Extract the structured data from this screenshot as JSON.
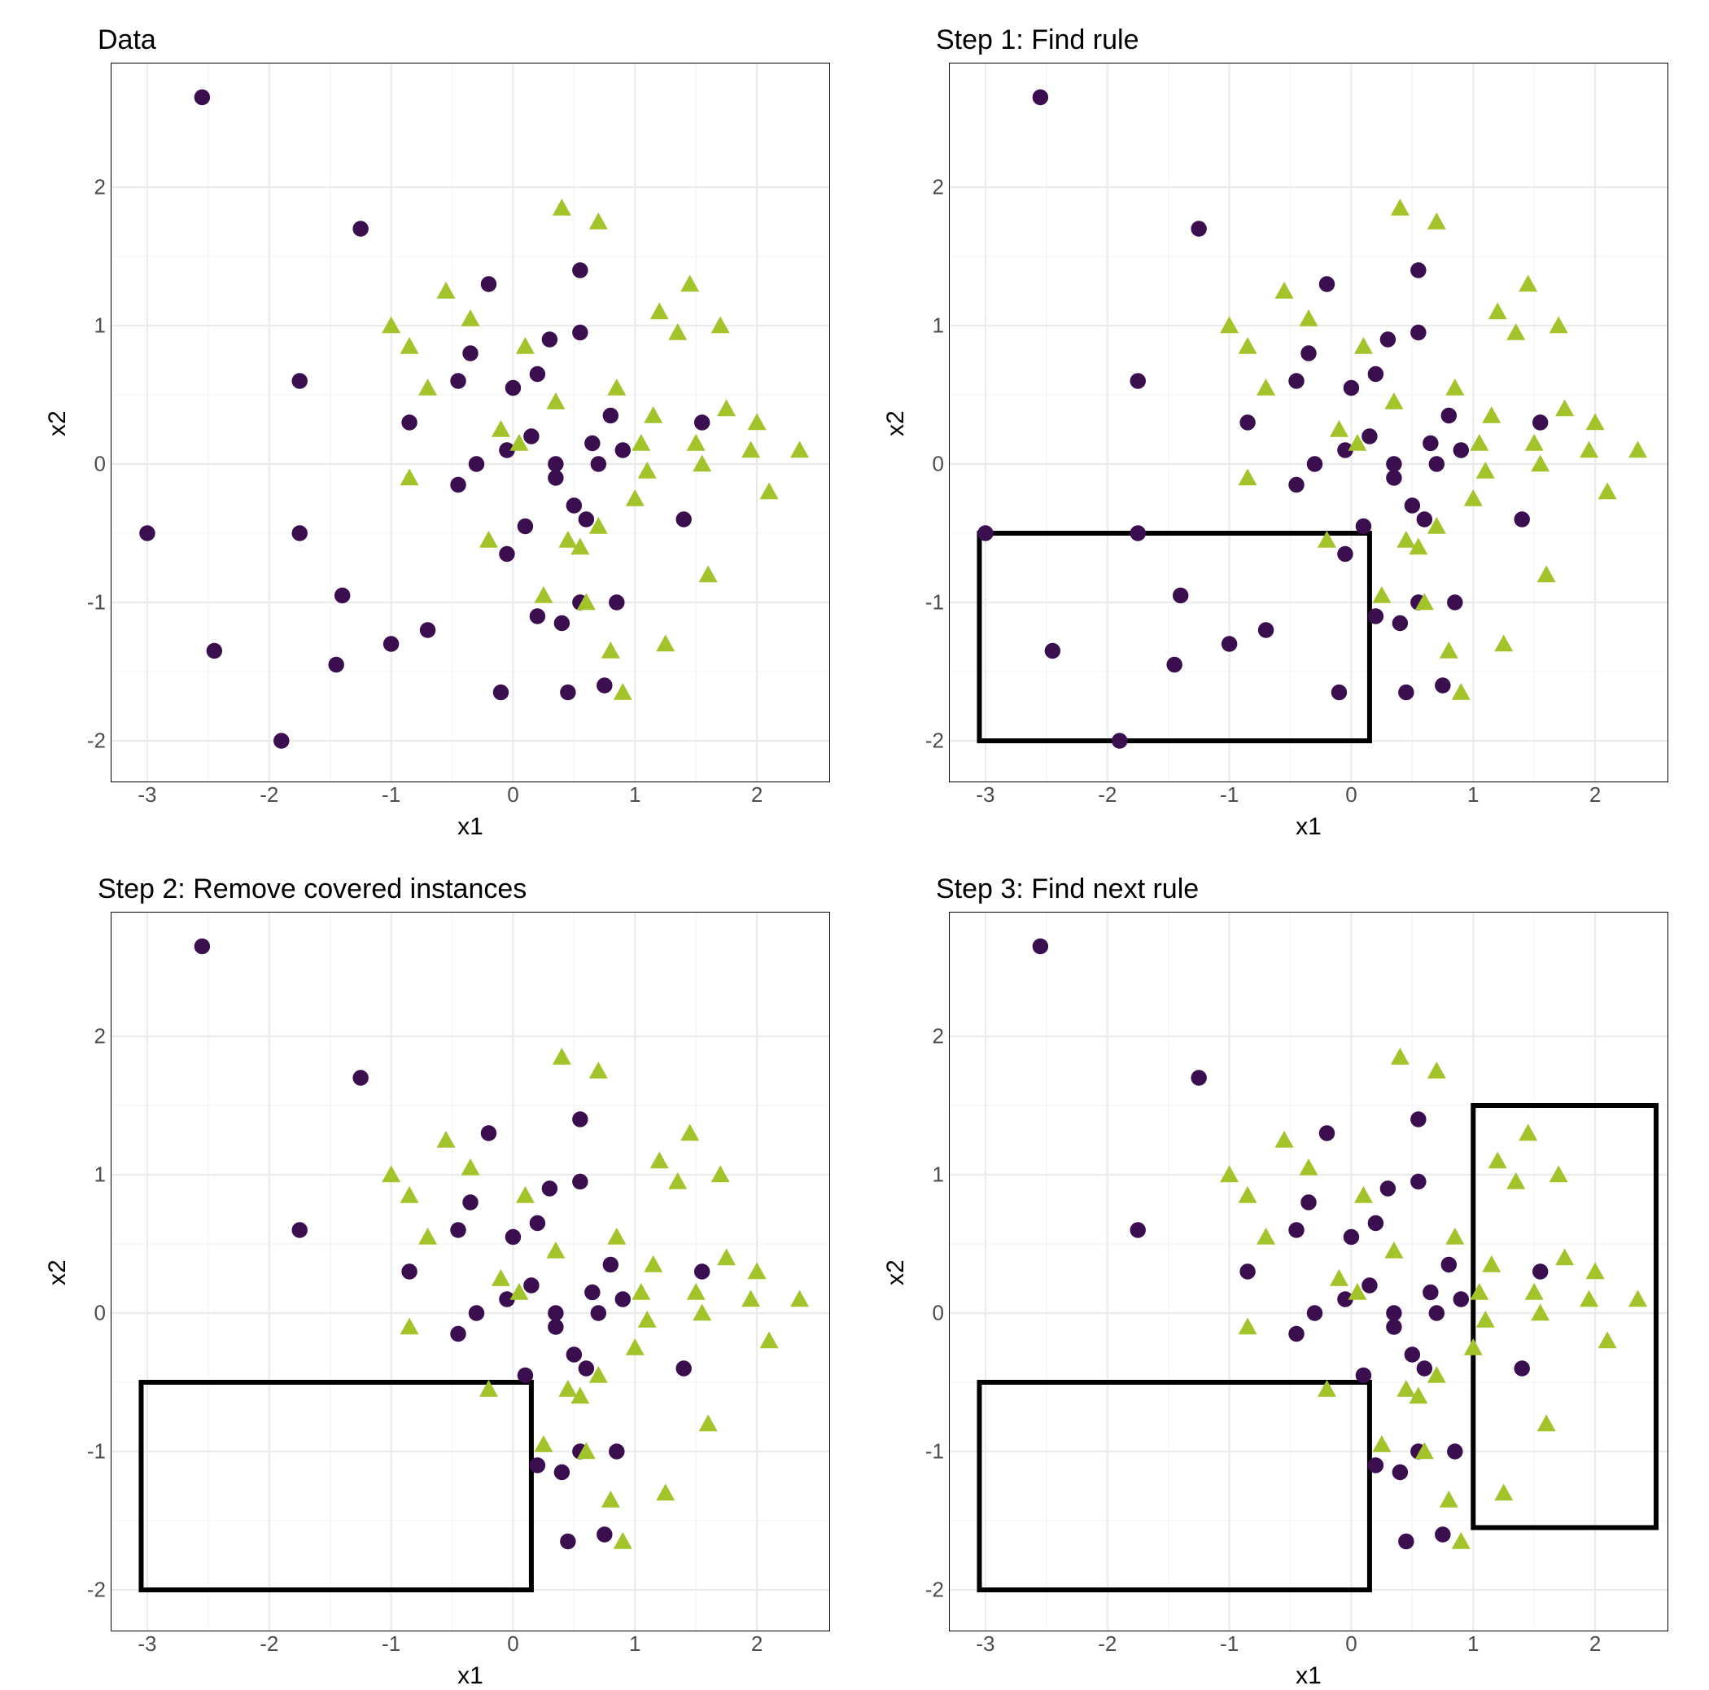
{
  "chart_data": [
    {
      "id": "p0",
      "title": "Data",
      "type": "scatter",
      "xlabel": "x1",
      "ylabel": "x2",
      "xlim": [
        -3.3,
        2.6
      ],
      "ylim": [
        -2.3,
        2.9
      ],
      "xticks": [
        -3,
        -2,
        -1,
        0,
        1,
        2
      ],
      "yticks": [
        -2,
        -1,
        0,
        1,
        2
      ],
      "rects": [],
      "series": [
        {
          "name": "circle",
          "color": "#3b0f4f",
          "shape": "circle",
          "x": [
            -2.55,
            -3.0,
            -2.45,
            -1.75,
            -1.9,
            -1.75,
            -1.45,
            -1.25,
            -1.4,
            -1.0,
            -0.7,
            -0.85,
            -0.45,
            -0.45,
            -0.3,
            -0.35,
            -0.2,
            -0.1,
            -0.05,
            -0.05,
            0.0,
            0.1,
            0.15,
            0.2,
            0.2,
            0.35,
            0.3,
            0.35,
            0.4,
            0.45,
            0.5,
            0.55,
            0.55,
            0.55,
            0.6,
            0.65,
            0.7,
            0.75,
            0.8,
            0.85,
            0.9,
            1.4,
            1.55
          ],
          "y": [
            2.65,
            -0.5,
            -1.35,
            0.6,
            -2.0,
            -0.5,
            -1.45,
            1.7,
            -0.95,
            -1.3,
            -1.2,
            0.3,
            -0.15,
            0.6,
            0.0,
            0.8,
            1.3,
            -1.65,
            -0.65,
            0.1,
            0.55,
            -0.45,
            0.2,
            -1.1,
            0.65,
            -0.1,
            0.9,
            0.0,
            -1.15,
            -1.65,
            -0.3,
            -1.0,
            0.95,
            1.4,
            -0.4,
            0.15,
            0.0,
            -1.6,
            0.35,
            -1.0,
            0.1,
            -0.4,
            0.3
          ]
        },
        {
          "name": "triangle",
          "color": "#a3c32b",
          "shape": "triangle",
          "x": [
            -1.0,
            -0.85,
            -0.85,
            -0.7,
            -0.55,
            -0.35,
            -0.2,
            -0.1,
            0.05,
            0.1,
            0.25,
            0.35,
            0.4,
            0.45,
            0.55,
            0.6,
            0.7,
            0.7,
            0.8,
            0.85,
            0.9,
            1.0,
            1.05,
            1.1,
            1.15,
            1.2,
            1.25,
            1.35,
            1.45,
            1.5,
            1.55,
            1.6,
            1.7,
            1.75,
            1.95,
            2.0,
            2.1,
            2.35
          ],
          "y": [
            1.0,
            0.85,
            -0.1,
            0.55,
            1.25,
            1.05,
            -0.55,
            0.25,
            0.15,
            0.85,
            -0.95,
            0.45,
            1.85,
            -0.55,
            -0.6,
            -1.0,
            1.75,
            -0.45,
            -1.35,
            0.55,
            -1.65,
            -0.25,
            0.15,
            -0.05,
            0.35,
            1.1,
            -1.3,
            0.95,
            1.3,
            0.15,
            0.0,
            -0.8,
            1.0,
            0.4,
            0.1,
            0.3,
            -0.2,
            0.1
          ]
        }
      ]
    },
    {
      "id": "p1",
      "title": "Step 1: Find rule",
      "type": "scatter",
      "xlabel": "x1",
      "ylabel": "x2",
      "xlim": [
        -3.3,
        2.6
      ],
      "ylim": [
        -2.3,
        2.9
      ],
      "xticks": [
        -3,
        -2,
        -1,
        0,
        1,
        2
      ],
      "yticks": [
        -2,
        -1,
        0,
        1,
        2
      ],
      "rects": [
        {
          "x0": -3.05,
          "x1": 0.15,
          "y0": -2.0,
          "y1": -0.5
        }
      ],
      "series": [
        {
          "name": "circle",
          "color": "#3b0f4f",
          "shape": "circle",
          "x": [
            -2.55,
            -3.0,
            -2.45,
            -1.75,
            -1.9,
            -1.75,
            -1.45,
            -1.25,
            -1.4,
            -1.0,
            -0.7,
            -0.85,
            -0.45,
            -0.45,
            -0.3,
            -0.35,
            -0.2,
            -0.1,
            -0.05,
            -0.05,
            0.0,
            0.1,
            0.15,
            0.2,
            0.2,
            0.35,
            0.3,
            0.35,
            0.4,
            0.45,
            0.5,
            0.55,
            0.55,
            0.55,
            0.6,
            0.65,
            0.7,
            0.75,
            0.8,
            0.85,
            0.9,
            1.4,
            1.55
          ],
          "y": [
            2.65,
            -0.5,
            -1.35,
            0.6,
            -2.0,
            -0.5,
            -1.45,
            1.7,
            -0.95,
            -1.3,
            -1.2,
            0.3,
            -0.15,
            0.6,
            0.0,
            0.8,
            1.3,
            -1.65,
            -0.65,
            0.1,
            0.55,
            -0.45,
            0.2,
            -1.1,
            0.65,
            -0.1,
            0.9,
            0.0,
            -1.15,
            -1.65,
            -0.3,
            -1.0,
            0.95,
            1.4,
            -0.4,
            0.15,
            0.0,
            -1.6,
            0.35,
            -1.0,
            0.1,
            -0.4,
            0.3
          ]
        },
        {
          "name": "triangle",
          "color": "#a3c32b",
          "shape": "triangle",
          "x": [
            -1.0,
            -0.85,
            -0.85,
            -0.7,
            -0.55,
            -0.35,
            -0.2,
            -0.1,
            0.05,
            0.1,
            0.25,
            0.35,
            0.4,
            0.45,
            0.55,
            0.6,
            0.7,
            0.7,
            0.8,
            0.85,
            0.9,
            1.0,
            1.05,
            1.1,
            1.15,
            1.2,
            1.25,
            1.35,
            1.45,
            1.5,
            1.55,
            1.6,
            1.7,
            1.75,
            1.95,
            2.0,
            2.1,
            2.35
          ],
          "y": [
            1.0,
            0.85,
            -0.1,
            0.55,
            1.25,
            1.05,
            -0.55,
            0.25,
            0.15,
            0.85,
            -0.95,
            0.45,
            1.85,
            -0.55,
            -0.6,
            -1.0,
            1.75,
            -0.45,
            -1.35,
            0.55,
            -1.65,
            -0.25,
            0.15,
            -0.05,
            0.35,
            1.1,
            -1.3,
            0.95,
            1.3,
            0.15,
            0.0,
            -0.8,
            1.0,
            0.4,
            0.1,
            0.3,
            -0.2,
            0.1
          ]
        }
      ]
    },
    {
      "id": "p2",
      "title": "Step 2: Remove covered instances",
      "type": "scatter",
      "xlabel": "x1",
      "ylabel": "x2",
      "xlim": [
        -3.3,
        2.6
      ],
      "ylim": [
        -2.3,
        2.9
      ],
      "xticks": [
        -3,
        -2,
        -1,
        0,
        1,
        2
      ],
      "yticks": [
        -2,
        -1,
        0,
        1,
        2
      ],
      "rects": [
        {
          "x0": -3.05,
          "x1": 0.15,
          "y0": -2.0,
          "y1": -0.5
        }
      ],
      "series": [
        {
          "name": "circle",
          "color": "#3b0f4f",
          "shape": "circle",
          "x": [
            -2.55,
            -1.75,
            -1.25,
            -0.85,
            -0.45,
            -0.45,
            -0.3,
            -0.35,
            -0.2,
            -0.05,
            0.0,
            0.1,
            0.15,
            0.2,
            0.2,
            0.35,
            0.3,
            0.35,
            0.4,
            0.45,
            0.5,
            0.55,
            0.55,
            0.55,
            0.6,
            0.65,
            0.7,
            0.75,
            0.8,
            0.85,
            0.9,
            1.4,
            1.55
          ],
          "y": [
            2.65,
            0.6,
            1.7,
            0.3,
            -0.15,
            0.6,
            0.0,
            0.8,
            1.3,
            0.1,
            0.55,
            -0.45,
            0.2,
            -1.1,
            0.65,
            -0.1,
            0.9,
            0.0,
            -1.15,
            -1.65,
            -0.3,
            -1.0,
            0.95,
            1.4,
            -0.4,
            0.15,
            0.0,
            -1.6,
            0.35,
            -1.0,
            0.1,
            -0.4,
            0.3
          ]
        },
        {
          "name": "triangle",
          "color": "#a3c32b",
          "shape": "triangle",
          "x": [
            -1.0,
            -0.85,
            -0.85,
            -0.7,
            -0.55,
            -0.35,
            -0.2,
            -0.1,
            0.05,
            0.1,
            0.25,
            0.35,
            0.4,
            0.45,
            0.55,
            0.6,
            0.7,
            0.7,
            0.8,
            0.85,
            0.9,
            1.0,
            1.05,
            1.1,
            1.15,
            1.2,
            1.25,
            1.35,
            1.45,
            1.5,
            1.55,
            1.6,
            1.7,
            1.75,
            1.95,
            2.0,
            2.1,
            2.35
          ],
          "y": [
            1.0,
            0.85,
            -0.1,
            0.55,
            1.25,
            1.05,
            -0.55,
            0.25,
            0.15,
            0.85,
            -0.95,
            0.45,
            1.85,
            -0.55,
            -0.6,
            -1.0,
            1.75,
            -0.45,
            -1.35,
            0.55,
            -1.65,
            -0.25,
            0.15,
            -0.05,
            0.35,
            1.1,
            -1.3,
            0.95,
            1.3,
            0.15,
            0.0,
            -0.8,
            1.0,
            0.4,
            0.1,
            0.3,
            -0.2,
            0.1
          ]
        }
      ]
    },
    {
      "id": "p3",
      "title": "Step 3: Find next rule",
      "type": "scatter",
      "xlabel": "x1",
      "ylabel": "x2",
      "xlim": [
        -3.3,
        2.6
      ],
      "ylim": [
        -2.3,
        2.9
      ],
      "xticks": [
        -3,
        -2,
        -1,
        0,
        1,
        2
      ],
      "yticks": [
        -2,
        -1,
        0,
        1,
        2
      ],
      "rects": [
        {
          "x0": -3.05,
          "x1": 0.15,
          "y0": -2.0,
          "y1": -0.5
        },
        {
          "x0": 1.0,
          "x1": 2.5,
          "y0": -1.55,
          "y1": 1.5
        }
      ],
      "series": [
        {
          "name": "circle",
          "color": "#3b0f4f",
          "shape": "circle",
          "x": [
            -2.55,
            -1.75,
            -1.25,
            -0.85,
            -0.45,
            -0.45,
            -0.3,
            -0.35,
            -0.2,
            -0.05,
            0.0,
            0.1,
            0.15,
            0.2,
            0.2,
            0.35,
            0.3,
            0.35,
            0.4,
            0.45,
            0.5,
            0.55,
            0.55,
            0.55,
            0.6,
            0.65,
            0.7,
            0.75,
            0.8,
            0.85,
            0.9,
            1.4,
            1.55
          ],
          "y": [
            2.65,
            0.6,
            1.7,
            0.3,
            -0.15,
            0.6,
            0.0,
            0.8,
            1.3,
            0.1,
            0.55,
            -0.45,
            0.2,
            -1.1,
            0.65,
            -0.1,
            0.9,
            0.0,
            -1.15,
            -1.65,
            -0.3,
            -1.0,
            0.95,
            1.4,
            -0.4,
            0.15,
            0.0,
            -1.6,
            0.35,
            -1.0,
            0.1,
            -0.4,
            0.3
          ]
        },
        {
          "name": "triangle",
          "color": "#a3c32b",
          "shape": "triangle",
          "x": [
            -1.0,
            -0.85,
            -0.85,
            -0.7,
            -0.55,
            -0.35,
            -0.2,
            -0.1,
            0.05,
            0.1,
            0.25,
            0.35,
            0.4,
            0.45,
            0.55,
            0.6,
            0.7,
            0.7,
            0.8,
            0.85,
            0.9,
            1.0,
            1.05,
            1.1,
            1.15,
            1.2,
            1.25,
            1.35,
            1.45,
            1.5,
            1.55,
            1.6,
            1.7,
            1.75,
            1.95,
            2.0,
            2.1,
            2.35
          ],
          "y": [
            1.0,
            0.85,
            -0.1,
            0.55,
            1.25,
            1.05,
            -0.55,
            0.25,
            0.15,
            0.85,
            -0.95,
            0.45,
            1.85,
            -0.55,
            -0.6,
            -1.0,
            1.75,
            -0.45,
            -1.35,
            0.55,
            -1.65,
            -0.25,
            0.15,
            -0.05,
            0.35,
            1.1,
            -1.3,
            0.95,
            1.3,
            0.15,
            0.0,
            -0.8,
            1.0,
            0.4,
            0.1,
            0.3,
            -0.2,
            0.1
          ]
        }
      ]
    }
  ],
  "colors": {
    "grid_major": "#ebebeb",
    "grid_minor": "#f5f5f5",
    "panel_border": "#000000",
    "circle": "#3b0f4f",
    "triangle": "#a3c32b",
    "rect": "#000000"
  }
}
